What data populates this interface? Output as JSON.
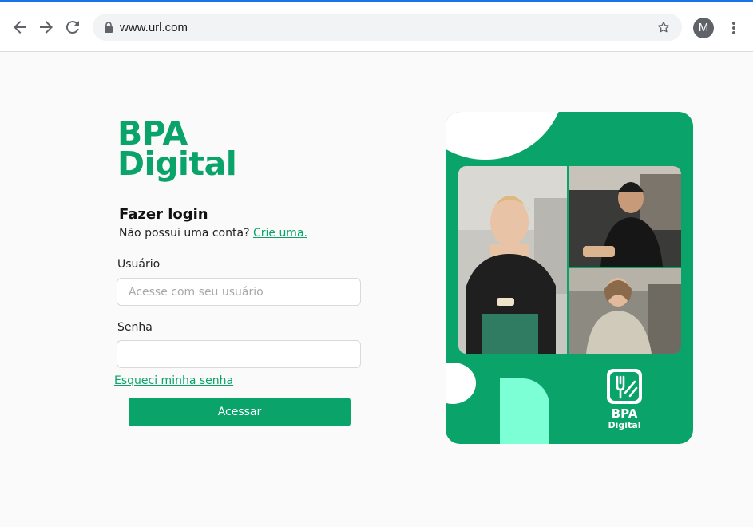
{
  "browser": {
    "url": "www.url.com",
    "profile_initial": "M"
  },
  "brand": {
    "line1": "BPA",
    "line2": "Digital",
    "color": "#0aa36a"
  },
  "login": {
    "title": "Fazer login",
    "no_account": "Não possui uma conta?",
    "create_link": "Crie uma.",
    "username_label": "Usuário",
    "username_placeholder": "Acesse com seu usuário",
    "username_value": "",
    "password_label": "Senha",
    "password_value": "",
    "forgot_link": "Esqueci minha senha",
    "submit_label": "Acessar"
  },
  "promo": {
    "brand_line1": "BPA",
    "brand_line2": "Digital",
    "accent": "#7dffd6",
    "photos": [
      "waitress-photo",
      "chef-photo",
      "cook-photo"
    ]
  }
}
